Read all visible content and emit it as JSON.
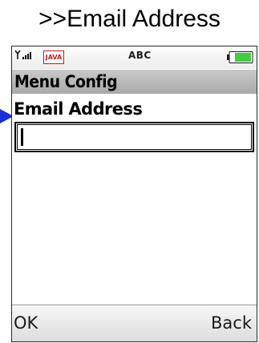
{
  "caption": ">>Email Address",
  "status_bar": {
    "signal_icon": "signal-strength-icon",
    "java_badge": "JAVA",
    "input_mode": "ABC",
    "battery_icon": "battery-icon"
  },
  "header": {
    "title": "Menu Config"
  },
  "form": {
    "field_label": "Email Address",
    "field_value": ""
  },
  "softkeys": {
    "left": "OK",
    "right": "Back"
  },
  "colors": {
    "pointer": "#1a2fd8",
    "java_badge": "#d01818",
    "battery_fill": "#3fcf3f",
    "title_bar": "#b9b9b9"
  }
}
